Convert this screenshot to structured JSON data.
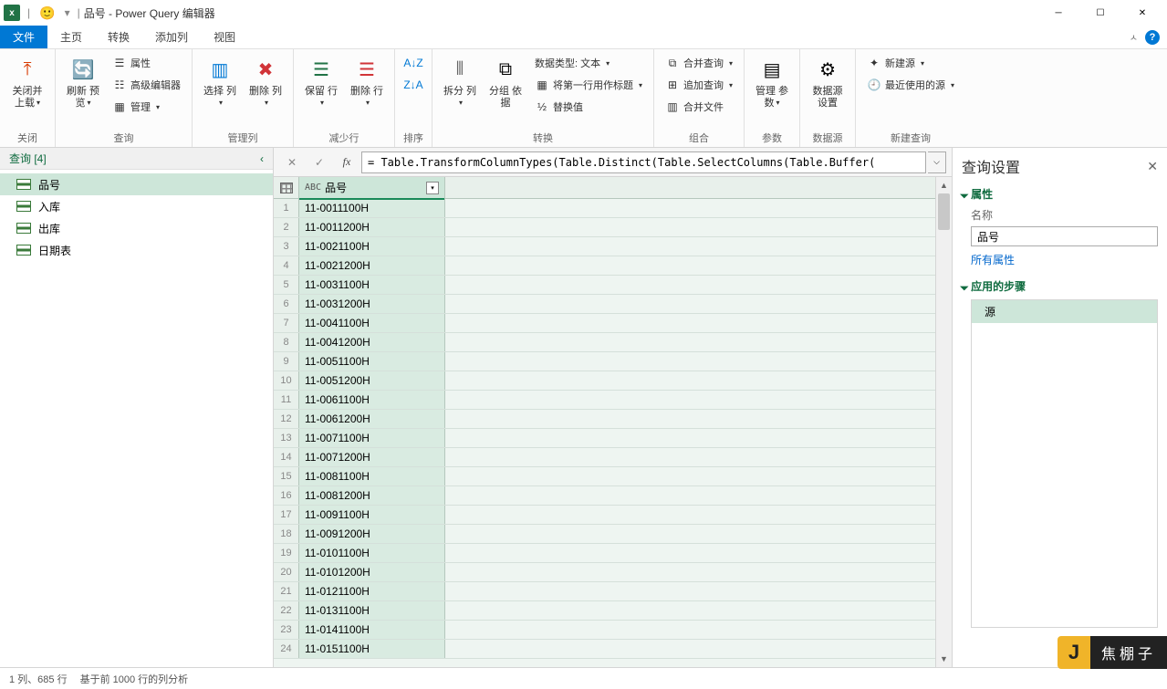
{
  "titlebar": {
    "title": "品号 - Power Query 编辑器",
    "dropdown": "▾"
  },
  "tabs": {
    "file": "文件",
    "home": "主页",
    "transform": "转换",
    "addcol": "添加列",
    "view": "视图"
  },
  "ribbon": {
    "close": {
      "btn": "关闭并\n上载",
      "label": "关闭"
    },
    "query": {
      "refresh": "刷新\n预览",
      "props": "属性",
      "advanced": "高级编辑器",
      "manage": "管理",
      "label": "查询"
    },
    "cols": {
      "choose": "选择\n列",
      "remove": "删除\n列",
      "label": "管理列"
    },
    "rows": {
      "keep": "保留\n行",
      "remove": "删除\n行",
      "label": "减少行"
    },
    "sort": {
      "label": "排序"
    },
    "transform": {
      "split": "拆分\n列",
      "group": "分组\n依据",
      "datatype": "数据类型: 文本",
      "firstrow": "将第一行用作标题",
      "replace": "替换值",
      "label": "转换"
    },
    "combine": {
      "merge": "合并查询",
      "append": "追加查询",
      "combine_files": "合并文件",
      "label": "组合"
    },
    "params": {
      "btn": "管理\n参数",
      "label": "参数"
    },
    "datasrc": {
      "btn": "数据源\n设置",
      "label": "数据源"
    },
    "newquery": {
      "new": "新建源",
      "recent": "最近使用的源",
      "label": "新建查询"
    }
  },
  "queries": {
    "header": "查询 [4]",
    "items": [
      {
        "label": "品号"
      },
      {
        "label": "入库"
      },
      {
        "label": "出库"
      },
      {
        "label": "日期表"
      }
    ]
  },
  "formula": "= Table.TransformColumnTypes(Table.Distinct(Table.SelectColumns(Table.Buffer(",
  "grid": {
    "column": "品号",
    "type_prefix": "ABC",
    "rows": [
      "11-0011100H",
      "11-0011200H",
      "11-0021100H",
      "11-0021200H",
      "11-0031100H",
      "11-0031200H",
      "11-0041100H",
      "11-0041200H",
      "11-0051100H",
      "11-0051200H",
      "11-0061100H",
      "11-0061200H",
      "11-0071100H",
      "11-0071200H",
      "11-0081100H",
      "11-0081200H",
      "11-0091100H",
      "11-0091200H",
      "11-0101100H",
      "11-0101200H",
      "11-0121100H",
      "11-0131100H",
      "11-0141100H",
      "11-0151100H"
    ]
  },
  "settings": {
    "title": "查询设置",
    "props": "属性",
    "name_label": "名称",
    "name_value": "品号",
    "all_props": "所有属性",
    "steps": "应用的步骤",
    "step0": "源"
  },
  "statusbar": {
    "cols_rows": "1 列、685 行",
    "profile": "基于前 1000 行的列分析"
  },
  "watermark": {
    "letter": "J",
    "text": "焦棚子"
  }
}
